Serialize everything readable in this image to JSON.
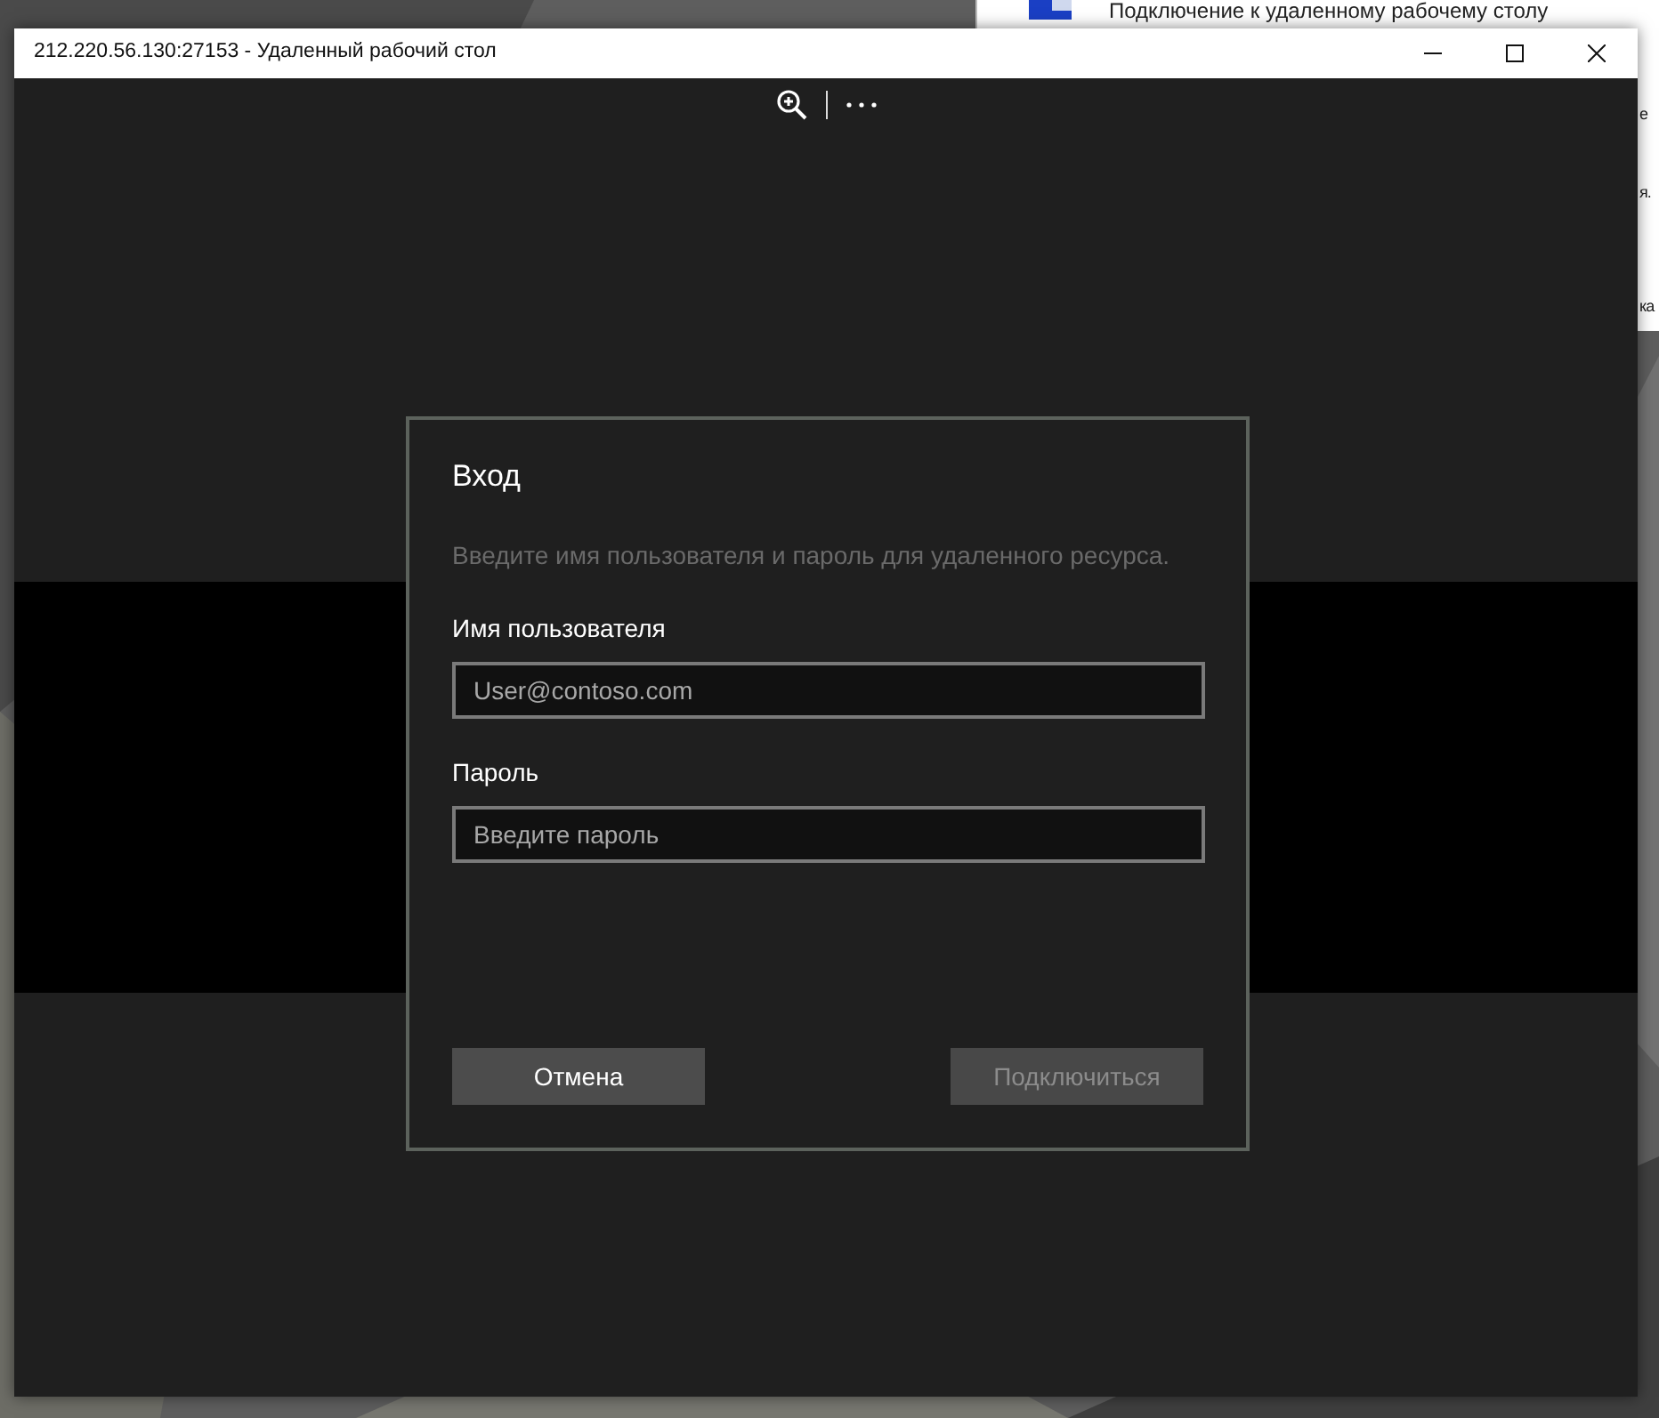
{
  "back_window": {
    "title": "Подключение к удаленному рабочему столу",
    "fragments": [
      "е",
      "я.",
      "ка"
    ]
  },
  "window": {
    "title": "212.220.56.130:27153 - Удаленный рабочий стол"
  },
  "dialog": {
    "title": "Вход",
    "subtitle": "Введите имя пользователя и пароль для удаленного ресурса.",
    "fields": [
      {
        "label": "Имя пользователя",
        "placeholder": "User@contoso.com"
      },
      {
        "label": "Пароль",
        "placeholder": "Введите пароль"
      }
    ],
    "buttons": [
      {
        "label": "Отмена",
        "disabled": false
      },
      {
        "label": "Подключиться",
        "disabled": true
      }
    ]
  }
}
